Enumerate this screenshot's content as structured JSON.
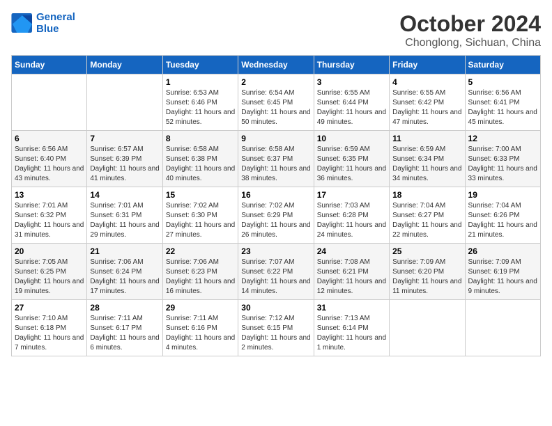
{
  "logo": {
    "line1": "General",
    "line2": "Blue"
  },
  "title": "October 2024",
  "location": "Chonglong, Sichuan, China",
  "days_of_week": [
    "Sunday",
    "Monday",
    "Tuesday",
    "Wednesday",
    "Thursday",
    "Friday",
    "Saturday"
  ],
  "weeks": [
    [
      {
        "day": "",
        "sunrise": "",
        "sunset": "",
        "daylight": ""
      },
      {
        "day": "",
        "sunrise": "",
        "sunset": "",
        "daylight": ""
      },
      {
        "day": "1",
        "sunrise": "Sunrise: 6:53 AM",
        "sunset": "Sunset: 6:46 PM",
        "daylight": "Daylight: 11 hours and 52 minutes."
      },
      {
        "day": "2",
        "sunrise": "Sunrise: 6:54 AM",
        "sunset": "Sunset: 6:45 PM",
        "daylight": "Daylight: 11 hours and 50 minutes."
      },
      {
        "day": "3",
        "sunrise": "Sunrise: 6:55 AM",
        "sunset": "Sunset: 6:44 PM",
        "daylight": "Daylight: 11 hours and 49 minutes."
      },
      {
        "day": "4",
        "sunrise": "Sunrise: 6:55 AM",
        "sunset": "Sunset: 6:42 PM",
        "daylight": "Daylight: 11 hours and 47 minutes."
      },
      {
        "day": "5",
        "sunrise": "Sunrise: 6:56 AM",
        "sunset": "Sunset: 6:41 PM",
        "daylight": "Daylight: 11 hours and 45 minutes."
      }
    ],
    [
      {
        "day": "6",
        "sunrise": "Sunrise: 6:56 AM",
        "sunset": "Sunset: 6:40 PM",
        "daylight": "Daylight: 11 hours and 43 minutes."
      },
      {
        "day": "7",
        "sunrise": "Sunrise: 6:57 AM",
        "sunset": "Sunset: 6:39 PM",
        "daylight": "Daylight: 11 hours and 41 minutes."
      },
      {
        "day": "8",
        "sunrise": "Sunrise: 6:58 AM",
        "sunset": "Sunset: 6:38 PM",
        "daylight": "Daylight: 11 hours and 40 minutes."
      },
      {
        "day": "9",
        "sunrise": "Sunrise: 6:58 AM",
        "sunset": "Sunset: 6:37 PM",
        "daylight": "Daylight: 11 hours and 38 minutes."
      },
      {
        "day": "10",
        "sunrise": "Sunrise: 6:59 AM",
        "sunset": "Sunset: 6:35 PM",
        "daylight": "Daylight: 11 hours and 36 minutes."
      },
      {
        "day": "11",
        "sunrise": "Sunrise: 6:59 AM",
        "sunset": "Sunset: 6:34 PM",
        "daylight": "Daylight: 11 hours and 34 minutes."
      },
      {
        "day": "12",
        "sunrise": "Sunrise: 7:00 AM",
        "sunset": "Sunset: 6:33 PM",
        "daylight": "Daylight: 11 hours and 33 minutes."
      }
    ],
    [
      {
        "day": "13",
        "sunrise": "Sunrise: 7:01 AM",
        "sunset": "Sunset: 6:32 PM",
        "daylight": "Daylight: 11 hours and 31 minutes."
      },
      {
        "day": "14",
        "sunrise": "Sunrise: 7:01 AM",
        "sunset": "Sunset: 6:31 PM",
        "daylight": "Daylight: 11 hours and 29 minutes."
      },
      {
        "day": "15",
        "sunrise": "Sunrise: 7:02 AM",
        "sunset": "Sunset: 6:30 PM",
        "daylight": "Daylight: 11 hours and 27 minutes."
      },
      {
        "day": "16",
        "sunrise": "Sunrise: 7:02 AM",
        "sunset": "Sunset: 6:29 PM",
        "daylight": "Daylight: 11 hours and 26 minutes."
      },
      {
        "day": "17",
        "sunrise": "Sunrise: 7:03 AM",
        "sunset": "Sunset: 6:28 PM",
        "daylight": "Daylight: 11 hours and 24 minutes."
      },
      {
        "day": "18",
        "sunrise": "Sunrise: 7:04 AM",
        "sunset": "Sunset: 6:27 PM",
        "daylight": "Daylight: 11 hours and 22 minutes."
      },
      {
        "day": "19",
        "sunrise": "Sunrise: 7:04 AM",
        "sunset": "Sunset: 6:26 PM",
        "daylight": "Daylight: 11 hours and 21 minutes."
      }
    ],
    [
      {
        "day": "20",
        "sunrise": "Sunrise: 7:05 AM",
        "sunset": "Sunset: 6:25 PM",
        "daylight": "Daylight: 11 hours and 19 minutes."
      },
      {
        "day": "21",
        "sunrise": "Sunrise: 7:06 AM",
        "sunset": "Sunset: 6:24 PM",
        "daylight": "Daylight: 11 hours and 17 minutes."
      },
      {
        "day": "22",
        "sunrise": "Sunrise: 7:06 AM",
        "sunset": "Sunset: 6:23 PM",
        "daylight": "Daylight: 11 hours and 16 minutes."
      },
      {
        "day": "23",
        "sunrise": "Sunrise: 7:07 AM",
        "sunset": "Sunset: 6:22 PM",
        "daylight": "Daylight: 11 hours and 14 minutes."
      },
      {
        "day": "24",
        "sunrise": "Sunrise: 7:08 AM",
        "sunset": "Sunset: 6:21 PM",
        "daylight": "Daylight: 11 hours and 12 minutes."
      },
      {
        "day": "25",
        "sunrise": "Sunrise: 7:09 AM",
        "sunset": "Sunset: 6:20 PM",
        "daylight": "Daylight: 11 hours and 11 minutes."
      },
      {
        "day": "26",
        "sunrise": "Sunrise: 7:09 AM",
        "sunset": "Sunset: 6:19 PM",
        "daylight": "Daylight: 11 hours and 9 minutes."
      }
    ],
    [
      {
        "day": "27",
        "sunrise": "Sunrise: 7:10 AM",
        "sunset": "Sunset: 6:18 PM",
        "daylight": "Daylight: 11 hours and 7 minutes."
      },
      {
        "day": "28",
        "sunrise": "Sunrise: 7:11 AM",
        "sunset": "Sunset: 6:17 PM",
        "daylight": "Daylight: 11 hours and 6 minutes."
      },
      {
        "day": "29",
        "sunrise": "Sunrise: 7:11 AM",
        "sunset": "Sunset: 6:16 PM",
        "daylight": "Daylight: 11 hours and 4 minutes."
      },
      {
        "day": "30",
        "sunrise": "Sunrise: 7:12 AM",
        "sunset": "Sunset: 6:15 PM",
        "daylight": "Daylight: 11 hours and 2 minutes."
      },
      {
        "day": "31",
        "sunrise": "Sunrise: 7:13 AM",
        "sunset": "Sunset: 6:14 PM",
        "daylight": "Daylight: 11 hours and 1 minute."
      },
      {
        "day": "",
        "sunrise": "",
        "sunset": "",
        "daylight": ""
      },
      {
        "day": "",
        "sunrise": "",
        "sunset": "",
        "daylight": ""
      }
    ]
  ]
}
